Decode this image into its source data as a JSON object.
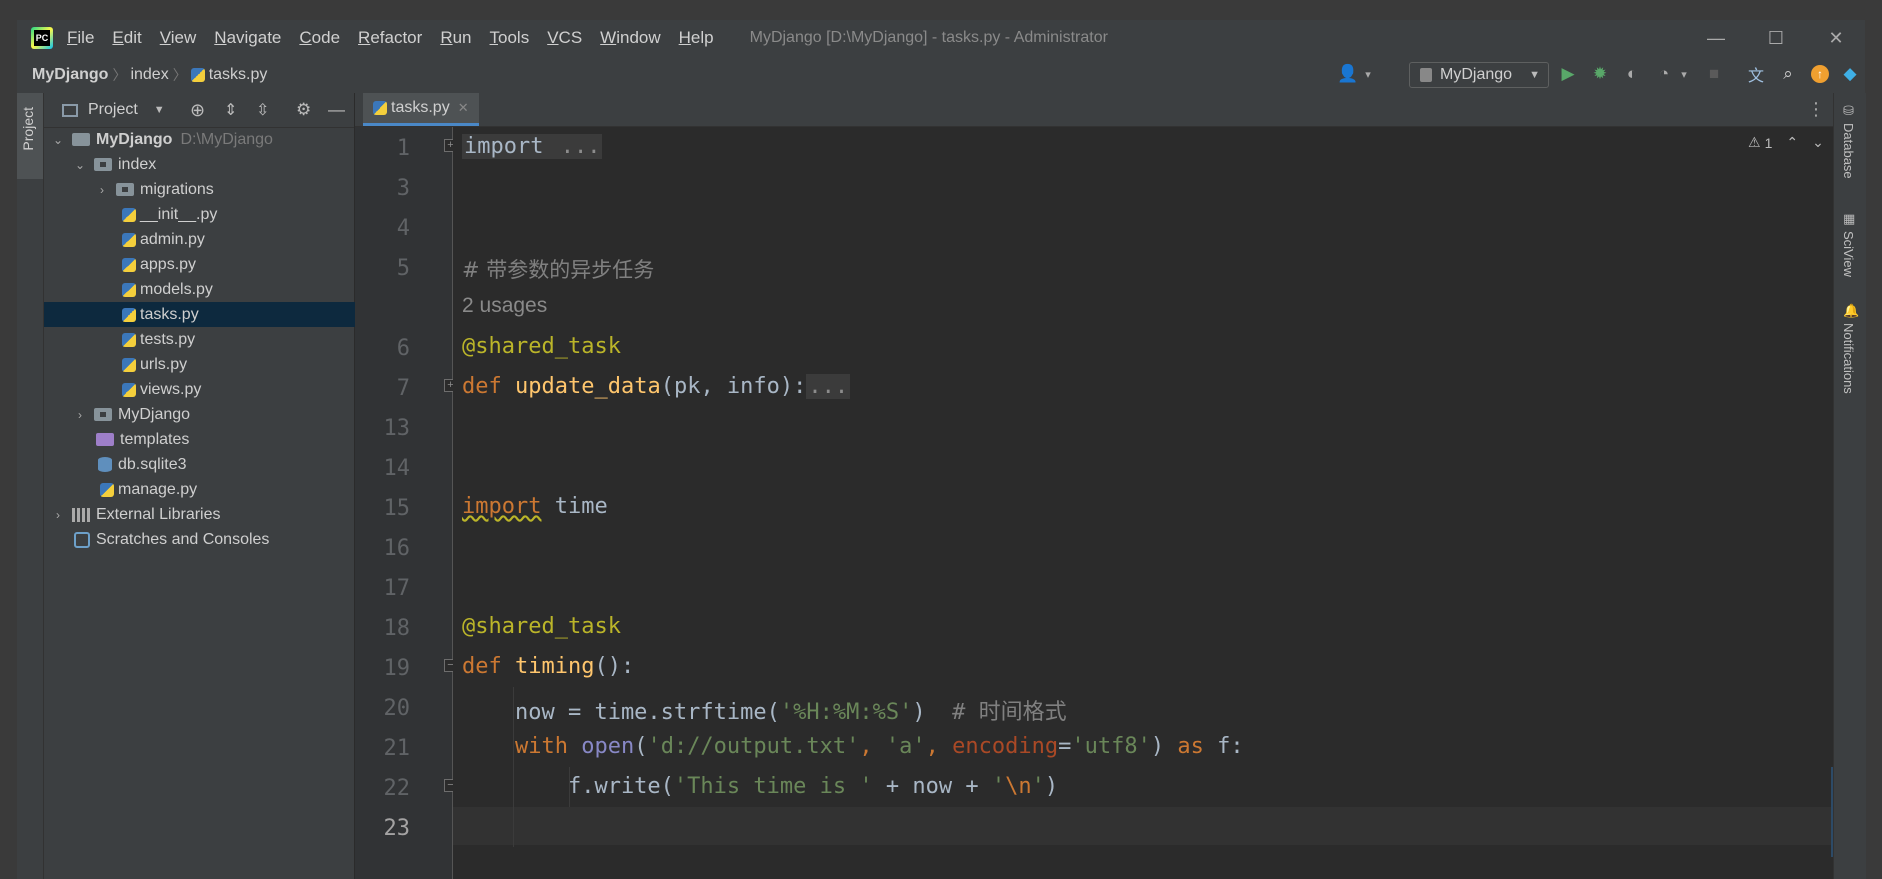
{
  "window": {
    "title": "MyDjango [D:\\MyDjango] - tasks.py - Administrator",
    "logo_text": "PC",
    "minimize": "—",
    "maximize": "☐",
    "close": "✕"
  },
  "menu": [
    "File",
    "Edit",
    "View",
    "Navigate",
    "Code",
    "Refactor",
    "Run",
    "Tools",
    "VCS",
    "Window",
    "Help"
  ],
  "breadcrumb": [
    "MyDjango",
    "index",
    "tasks.py"
  ],
  "toolbar": {
    "run_config": "MyDjango",
    "icons": [
      "user-icon",
      "run-icon",
      "debug-icon",
      "coverage-icon",
      "profile-icon",
      "stop-icon",
      "translate-icon",
      "search-icon",
      "update-icon",
      "plugin-icon"
    ]
  },
  "left_strip": {
    "project_tab": "Project"
  },
  "project_panel": {
    "title": "Project",
    "tree": [
      {
        "label": "MyDjango",
        "extra": "D:\\MyDjango"
      },
      {
        "label": "index"
      },
      {
        "label": "migrations"
      },
      {
        "label": "__init__.py"
      },
      {
        "label": "admin.py"
      },
      {
        "label": "apps.py"
      },
      {
        "label": "models.py"
      },
      {
        "label": "tasks.py"
      },
      {
        "label": "tests.py"
      },
      {
        "label": "urls.py"
      },
      {
        "label": "views.py"
      },
      {
        "label": "MyDjango"
      },
      {
        "label": "templates"
      },
      {
        "label": "db.sqlite3"
      },
      {
        "label": "manage.py"
      },
      {
        "label": "External Libraries"
      },
      {
        "label": "Scratches and Consoles"
      }
    ]
  },
  "editor": {
    "tab": "tasks.py",
    "warning_count": "1",
    "line_numbers": [
      "1",
      "3",
      "4",
      "5",
      "6",
      "7",
      "13",
      "14",
      "15",
      "16",
      "17",
      "18",
      "19",
      "20",
      "21",
      "22",
      "23"
    ],
    "usages_hint": "2 usages",
    "code": {
      "l1_kw": "import",
      "l1_fold": " ...",
      "l5_comment": "# 带参数的异步任务",
      "l6_dec": "@shared_task",
      "l7_kw": "def",
      "l7_fn": "update_data",
      "l7_rest": "(pk, info):",
      "l7_fold": "...",
      "l15_kw": "import",
      "l15_rest": " time",
      "l18_dec": "@shared_task",
      "l19_kw": "def",
      "l19_fn": "timing",
      "l19_rest": "():",
      "l20_a": "    now = time.strftime(",
      "l20_str": "'%H:%M:%S'",
      "l20_b": ")  ",
      "l20_cm": "# 时间格式",
      "l21_kw": "    with",
      "l21_sp": " ",
      "l21_bi": "open",
      "l21_p1": "(",
      "l21_s1": "'d://output.txt'",
      "l21_c1": ", ",
      "l21_s2": "'a'",
      "l21_c2": ", ",
      "l21_kwarg": "encoding",
      "l21_eq": "=",
      "l21_s3": "'utf8'",
      "l21_p2": ") ",
      "l21_as": "as",
      "l21_f": " f:",
      "l22_a": "        f.write(",
      "l22_s1": "'This time is '",
      "l22_b": " + now + ",
      "l22_s2a": "'",
      "l22_esc": "\\n",
      "l22_s2b": "'",
      "l22_c": ")"
    }
  },
  "right_strip": [
    "Database",
    "SciView",
    "Notifications"
  ],
  "colors": {
    "background": "#2b2b2b",
    "panel": "#3c3f41",
    "keyword": "#cc7832",
    "decorator": "#bbb529",
    "function": "#ffc66d",
    "string": "#6a8759",
    "comment": "#808080",
    "selection": "#0d293e"
  }
}
